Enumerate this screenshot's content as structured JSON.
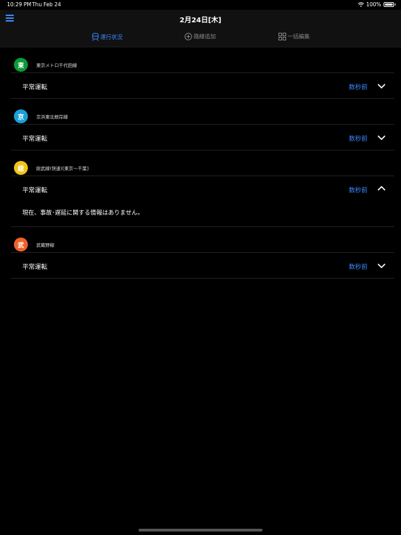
{
  "status_bar": {
    "time": "10:29 PM",
    "date": "Thu Feb 24",
    "battery": "100%"
  },
  "header": {
    "title": "2月24日[木]"
  },
  "tabs": [
    {
      "label": "運行状況",
      "active": true
    },
    {
      "label": "路線追加",
      "active": false
    },
    {
      "label": "一括編集",
      "active": false
    }
  ],
  "routes": [
    {
      "symbol": "東",
      "color": "#0a9a3a",
      "name": "東京メトロ千代田線",
      "status": "平常運転",
      "updated": "数秒前",
      "expanded": false
    },
    {
      "symbol": "京",
      "color": "#1aa0d8",
      "name": "京浜東北根岸線",
      "status": "平常運転",
      "updated": "数秒前",
      "expanded": false
    },
    {
      "symbol": "総",
      "color": "#f2c418",
      "name": "総武線(快速)[東京〜千葉]",
      "status": "平常運転",
      "updated": "数秒前",
      "expanded": true,
      "detail": "現在、事故･遅延に関する情報はありません。"
    },
    {
      "symbol": "武",
      "color": "#f0612a",
      "name": "武蔵野線",
      "status": "平常運転",
      "updated": "数秒前",
      "expanded": false
    }
  ]
}
